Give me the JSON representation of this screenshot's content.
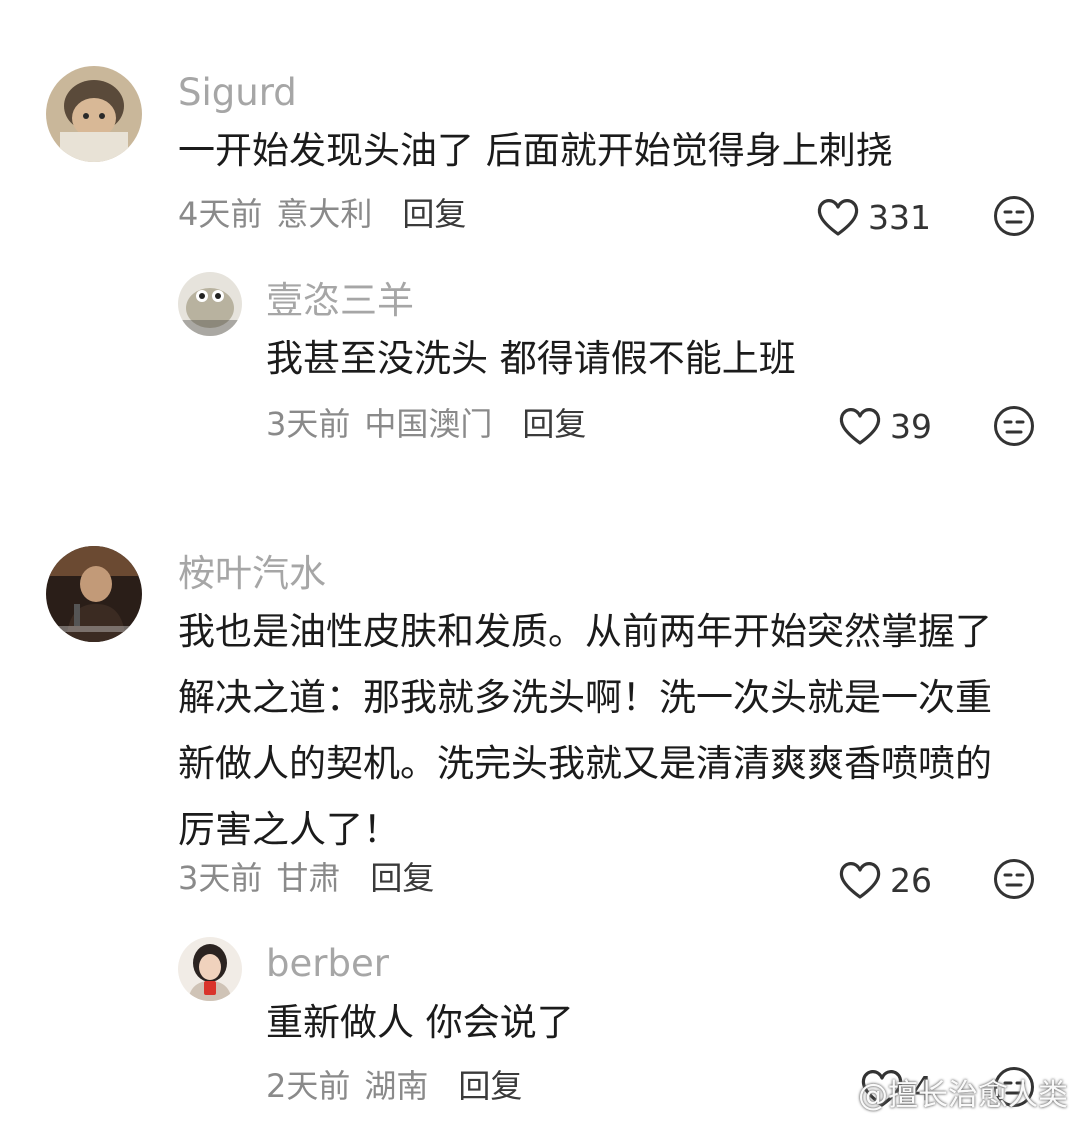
{
  "comments": [
    {
      "username": "Sigurd",
      "text_lines": [
        "一开始发现头油了 后面就开始觉得身上刺挠"
      ],
      "time": "4天前",
      "location": "意大利",
      "reply": "回复",
      "likes": "331"
    },
    {
      "username": "壹恣三羊",
      "text_lines": [
        "我甚至没洗头 都得请假不能上班"
      ],
      "time": "3天前",
      "location": "中国澳门",
      "reply": "回复",
      "likes": "39"
    },
    {
      "username": "桉叶汽水",
      "text_lines": [
        "我也是油性皮肤和发质。从前两年开始突然掌握了",
        "解决之道：那我就多洗头啊！洗一次头就是一次重",
        "新做人的契机。洗完头我就又是清清爽爽香喷喷的",
        "厉害之人了！"
      ],
      "time": "3天前",
      "location": "甘肃",
      "reply": "回复",
      "likes": "26"
    },
    {
      "username": "berber",
      "text_lines": [
        "重新做人 你会说了"
      ],
      "time": "2天前",
      "location": "湖南",
      "reply": "回复",
      "likes": "4"
    }
  ],
  "watermark": {
    "text": "@擅长治愈人类",
    "icon": "weibo-logo-icon"
  },
  "colors": {
    "username": "#a6a6a6",
    "meta": "#8a8a8a",
    "text": "#1b1b1b"
  }
}
